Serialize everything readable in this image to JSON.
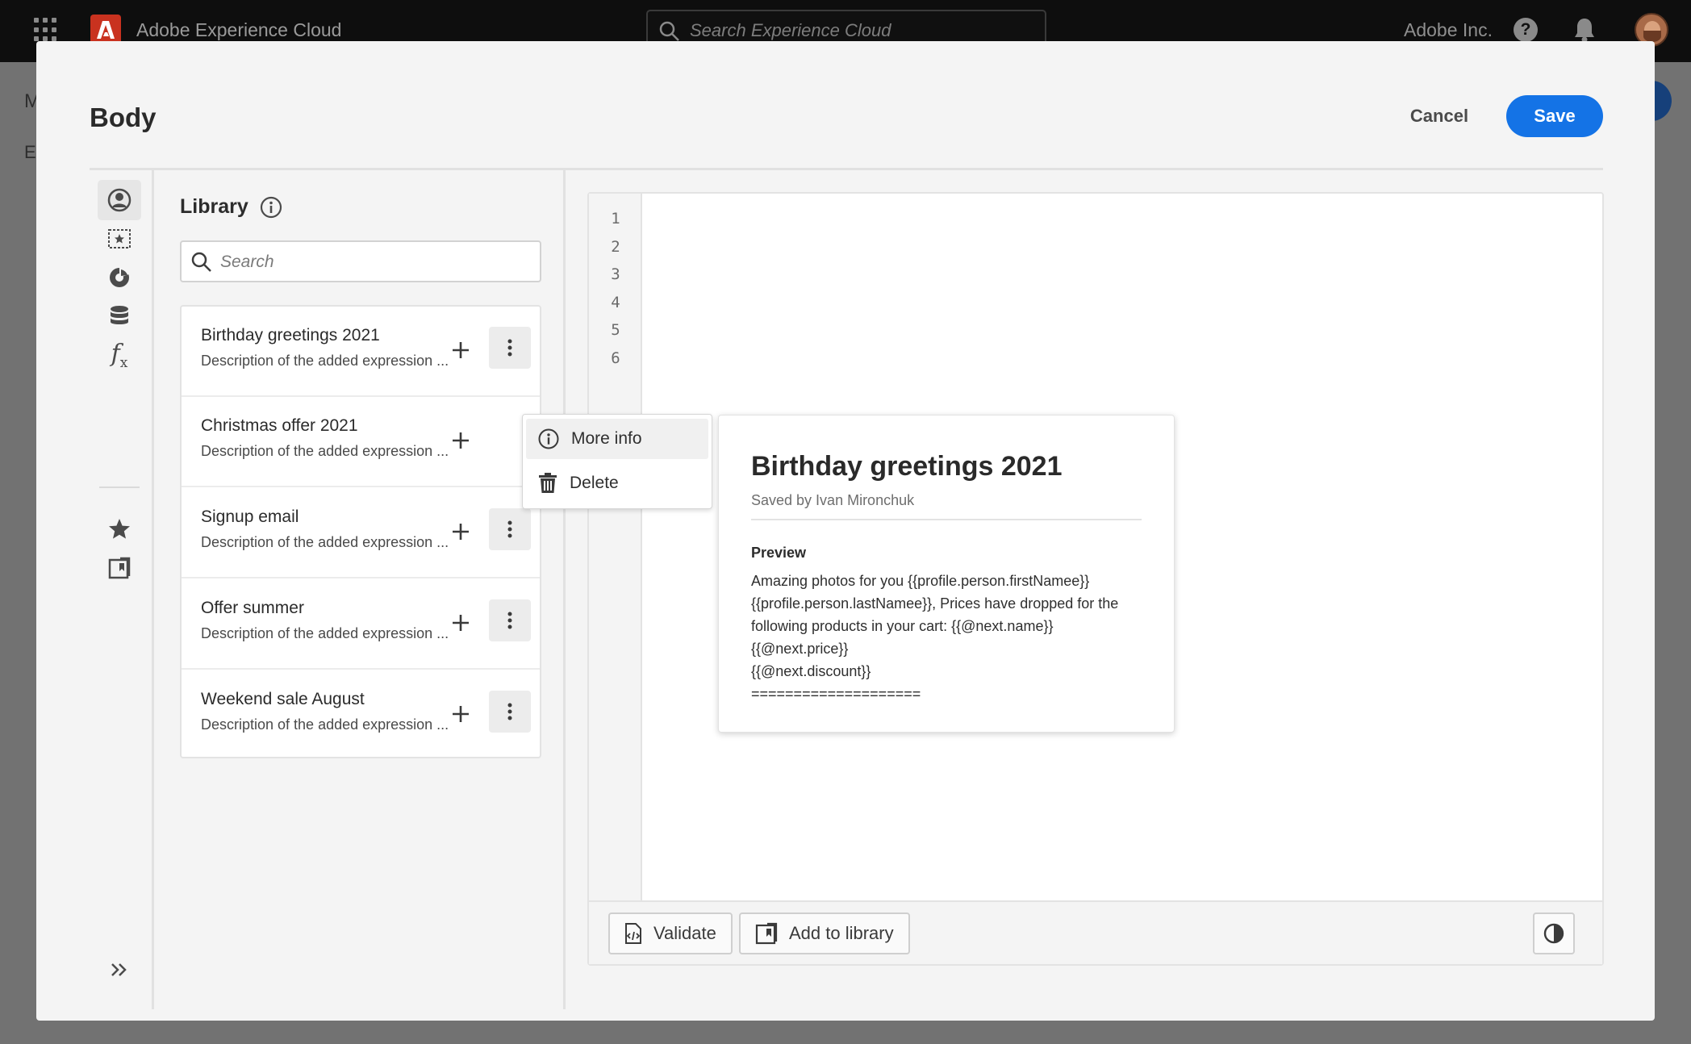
{
  "topbar": {
    "brand": "Adobe Experience Cloud",
    "search_placeholder": "Search Experience Cloud",
    "org": "Adobe Inc.",
    "help": "?"
  },
  "background": {
    "letter_m": "M",
    "letter_e": "E"
  },
  "modal": {
    "title": "Body",
    "cancel_label": "Cancel",
    "save_label": "Save",
    "accent_color": "#1473e6"
  },
  "rail": {
    "items": [
      {
        "name": "profile-attributes",
        "icon": "user-circle-icon",
        "active": true
      },
      {
        "name": "audiences",
        "icon": "star-box-icon"
      },
      {
        "name": "contextual-attributes",
        "icon": "segment-icon"
      },
      {
        "name": "data-sources",
        "icon": "database-icon"
      },
      {
        "name": "helper-functions",
        "icon": "function-icon",
        "label": "f"
      },
      {
        "name": "favorites",
        "icon": "star-icon"
      },
      {
        "name": "library",
        "icon": "library-icon"
      }
    ],
    "expand_icon": "double-chevron-right-icon"
  },
  "library": {
    "title": "Library",
    "search_placeholder": "Search",
    "items": [
      {
        "name": "Birthday greetings 2021",
        "description": "Description of the added expression ..."
      },
      {
        "name": "Christmas offer 2021",
        "description": "Description of the added expression ..."
      },
      {
        "name": "Signup email",
        "description": "Description of the added expression ..."
      },
      {
        "name": "Offer summer",
        "description": "Description of the added expression ..."
      },
      {
        "name": "Weekend sale August",
        "description": "Description of the added expression ..."
      }
    ]
  },
  "context_menu": {
    "items": [
      {
        "label": "More info",
        "icon": "info-icon"
      },
      {
        "label": "Delete",
        "icon": "trash-icon"
      }
    ]
  },
  "editor": {
    "line_numbers": [
      "1",
      "2",
      "3",
      "4",
      "5",
      "6"
    ],
    "validate_label": "Validate",
    "add_to_library_label": "Add to library"
  },
  "preview_card": {
    "title": "Birthday greetings 2021",
    "saved_by": "Saved by Ivan Mironchuk",
    "preview_heading": "Preview",
    "preview_lines": [
      "Amazing photos for you {{profile.person.firstNamee}}",
      "{{profile.person.lastNamee}}, Prices have dropped for the",
      "following products in your cart: {{@next.name}}",
      "{{@next.price}}",
      "{{@next.discount}}",
      "===================="
    ]
  }
}
